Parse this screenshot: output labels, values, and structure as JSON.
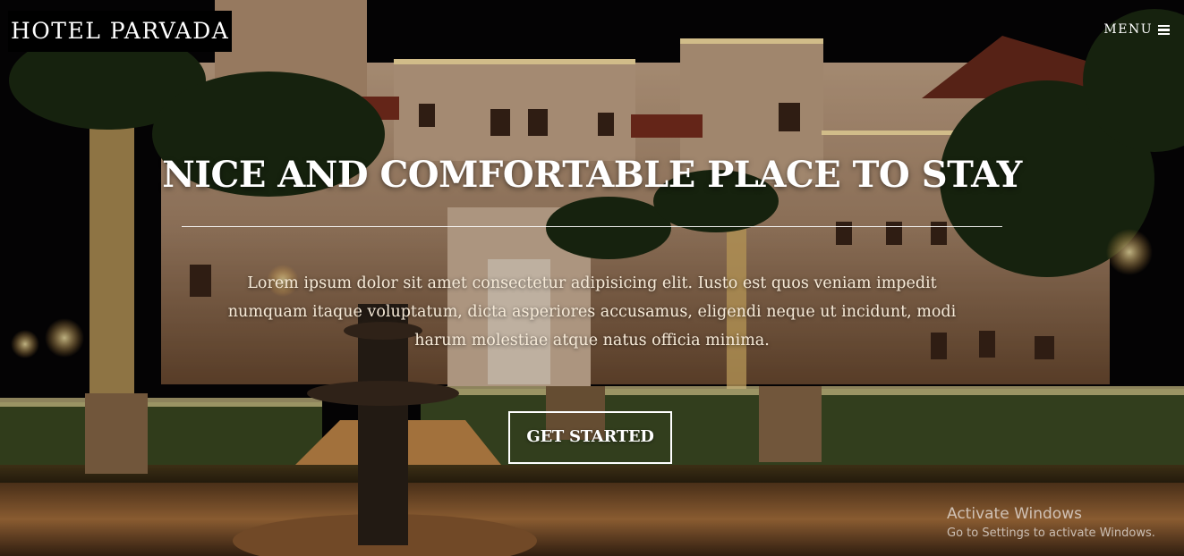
{
  "header": {
    "brand": "HOTEL PARVADA",
    "menu_label": "MENU",
    "menu_icon": "bars-icon"
  },
  "hero": {
    "title": "NICE AND COMFORTABLE PLACE TO STAY",
    "lead": "Lorem ipsum dolor sit amet consectetur adipisicing elit. Iusto est quos veniam impedit numquam itaque voluptatum, dicta asperiores accusamus, eligendi neque ut incidunt, modi harum molestiae atque natus officia minima.",
    "cta_label": "GET STARTED",
    "background": "night-hotel-courtyard-with-lights"
  },
  "os_watermark": {
    "title": "Activate Windows",
    "subtitle": "Go to Settings to activate Windows."
  },
  "colors": {
    "text": "#ffffff",
    "brand_bg": "#000000",
    "sky": "#050406",
    "warm_light": "#ffb347"
  }
}
